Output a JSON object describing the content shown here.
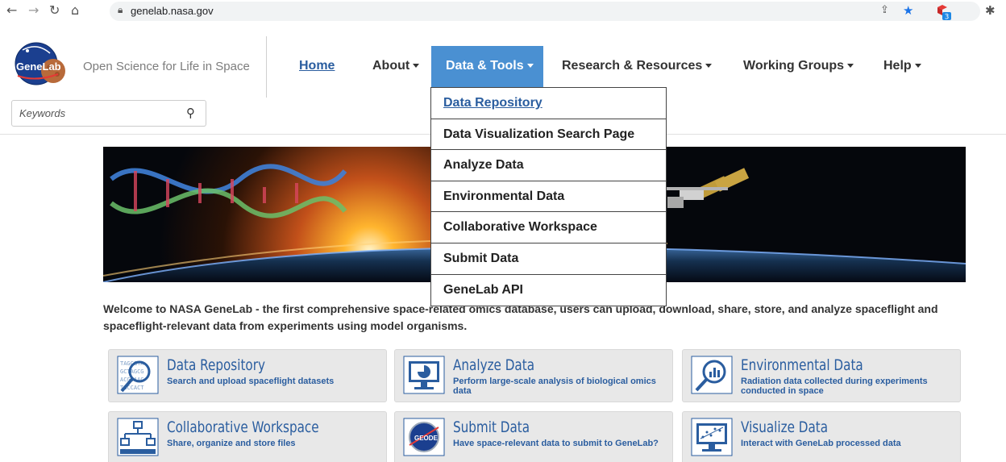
{
  "browser": {
    "url": "genelab.nasa.gov",
    "extension_badge": "3"
  },
  "header": {
    "logo_text": "GeneLab",
    "tagline": "Open Science for Life in Space",
    "search_placeholder": "Keywords"
  },
  "nav": {
    "items": [
      {
        "label": "Home"
      },
      {
        "label": "About"
      },
      {
        "label": "Data & Tools"
      },
      {
        "label": "Research & Resources"
      },
      {
        "label": "Working Groups"
      },
      {
        "label": "Help"
      }
    ]
  },
  "dropdown": {
    "items": [
      {
        "label": "Data Repository"
      },
      {
        "label": "Data Visualization Search Page"
      },
      {
        "label": "Analyze Data"
      },
      {
        "label": "Environmental Data"
      },
      {
        "label": "Collaborative Workspace"
      },
      {
        "label": "Submit Data"
      },
      {
        "label": "GeneLab API"
      }
    ]
  },
  "welcome": "Welcome to NASA GeneLab - the first comprehensive space-related omics database, users can upload, download, share, store, and analyze spaceflight and spaceflight-relevant data from experiments using model organisms.",
  "tiles": [
    {
      "title": "Data Repository",
      "desc": "Search and upload spaceflight datasets"
    },
    {
      "title": "Analyze Data",
      "desc": "Perform large-scale analysis of biological omics data"
    },
    {
      "title": "Environmental Data",
      "desc": "Radiation data collected during experiments conducted in space"
    },
    {
      "title": "Collaborative Workspace",
      "desc": "Share, organize and store files"
    },
    {
      "title": "Submit Data",
      "desc": "Have space-relevant data to submit to GeneLab?"
    },
    {
      "title": "Visualize Data",
      "desc": "Interact with GeneLab processed data"
    }
  ],
  "colors": {
    "brand_blue": "#2a5d9f",
    "nav_active": "#4a90d2",
    "tile_bg": "#e8e8e8"
  }
}
